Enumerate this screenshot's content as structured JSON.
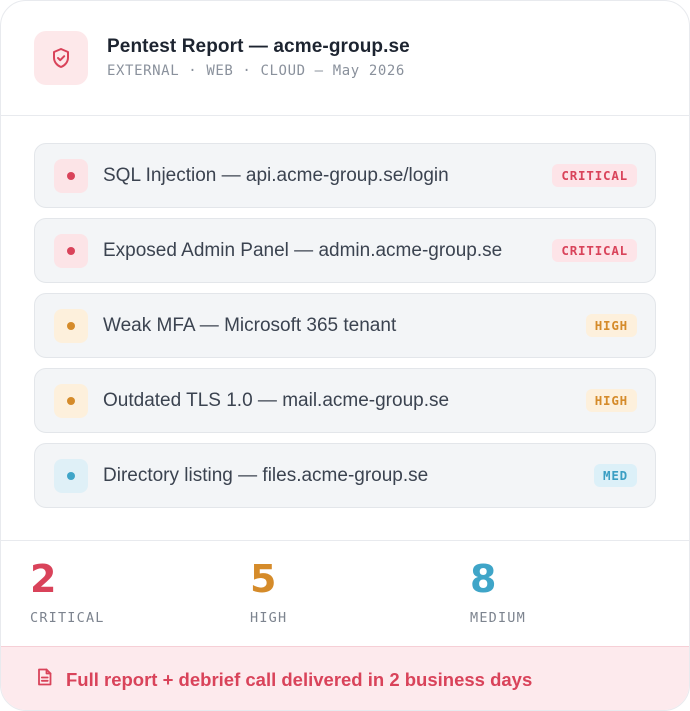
{
  "header": {
    "icon": "shield-check-icon",
    "title": "Pentest Report — acme-group.se",
    "subtitle": "EXTERNAL · WEB · CLOUD — May 2026"
  },
  "findings": [
    {
      "label": "SQL Injection — api.acme-group.se/login",
      "severity": "CRITICAL"
    },
    {
      "label": "Exposed Admin Panel — admin.acme-group.se",
      "severity": "CRITICAL"
    },
    {
      "label": "Weak MFA — Microsoft 365 tenant",
      "severity": "HIGH"
    },
    {
      "label": "Outdated TLS 1.0 — mail.acme-group.se",
      "severity": "HIGH"
    },
    {
      "label": "Directory listing — files.acme-group.se",
      "severity": "MED"
    }
  ],
  "stats": [
    {
      "value": "2",
      "label": "CRITICAL",
      "color": "#d9435a"
    },
    {
      "value": "5",
      "label": "HIGH",
      "color": "#d58b2a"
    },
    {
      "value": "8",
      "label": "MEDIUM",
      "color": "#3fa5c8"
    }
  ],
  "footer": {
    "icon": "document-icon",
    "text": "Full report + debrief call delivered in 2 business days"
  },
  "colors": {
    "critical": "#d9435a",
    "high": "#d58b2a",
    "medium": "#3fa5c8"
  }
}
